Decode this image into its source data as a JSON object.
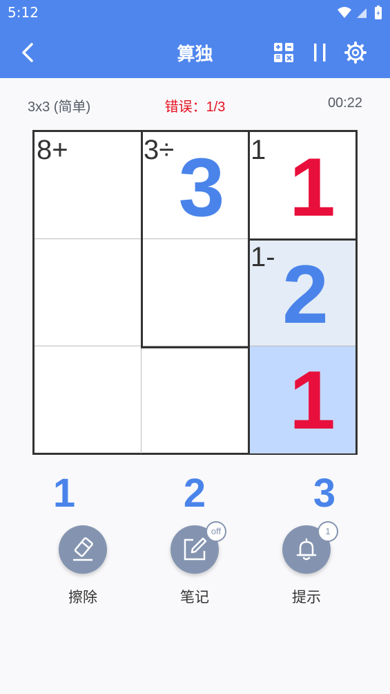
{
  "status_bar": {
    "time": "5:12"
  },
  "app_bar": {
    "title": "算独"
  },
  "info": {
    "difficulty": "3x3 (简单)",
    "errors": "错误：1/3",
    "timer": "00:22"
  },
  "board": {
    "size": 3,
    "cells": [
      {
        "row": 0,
        "col": 0,
        "clue": "8+",
        "value": "",
        "color": ""
      },
      {
        "row": 0,
        "col": 1,
        "clue": "3÷",
        "value": "3",
        "color": "blue"
      },
      {
        "row": 0,
        "col": 2,
        "clue": "1",
        "value": "1",
        "color": "red"
      },
      {
        "row": 1,
        "col": 0,
        "clue": "",
        "value": "",
        "color": ""
      },
      {
        "row": 1,
        "col": 1,
        "clue": "",
        "value": "",
        "color": ""
      },
      {
        "row": 1,
        "col": 2,
        "clue": "1-",
        "value": "2",
        "color": "blue",
        "highlight": "#e4ecf7"
      },
      {
        "row": 2,
        "col": 0,
        "clue": "",
        "value": "",
        "color": ""
      },
      {
        "row": 2,
        "col": 1,
        "clue": "",
        "value": "",
        "color": ""
      },
      {
        "row": 2,
        "col": 2,
        "clue": "",
        "value": "1",
        "color": "red",
        "highlight": "#c2d9ff"
      }
    ]
  },
  "number_pad": [
    "1",
    "2",
    "3"
  ],
  "tools": {
    "erase": {
      "label": "擦除",
      "icon": "eraser-icon"
    },
    "notes": {
      "label": "笔记",
      "icon": "edit-icon",
      "badge": "off"
    },
    "hint": {
      "label": "提示",
      "icon": "bell-icon",
      "badge": "1"
    }
  },
  "colors": {
    "accent": "#4f86ee",
    "error": "#e6101f",
    "tool": "#8494b0"
  }
}
